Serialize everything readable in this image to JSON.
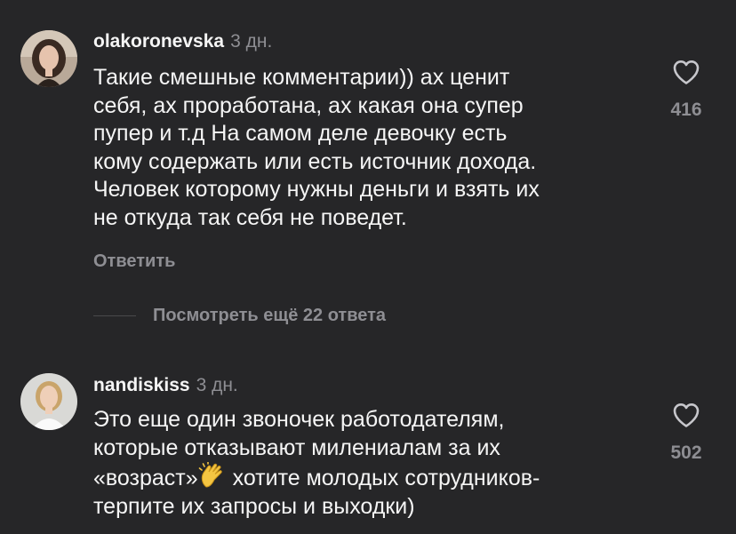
{
  "comments": [
    {
      "username": "olakoronevska",
      "time": "3 дн.",
      "text": "Такие смешные комментарии)) ах ценит\nсебя, ах проработана, ах какая она супер\nпупер  и т.д На самом деле девочку есть\nкому содержать или есть источник дохода.\nЧеловек которому нужны деньги и взять их\nне откуда так себя не поведет.",
      "likes": "416",
      "reply_label": "Ответить",
      "view_replies": "Посмотреть ещё 22 ответа",
      "icons": {
        "like": "heart-icon",
        "avatar": "avatar"
      }
    },
    {
      "username": "nandiskiss",
      "time": "3 дн.",
      "text_before_emoji": "Это еще один звоночек работодателям,\nкоторые отказывают милениалам за их\n«возраст»",
      "text_after_emoji": " хотите молодых сотрудников-\nтерпите их запросы и выходки)",
      "emoji": "clapping-hands-emoji",
      "likes": "502",
      "icons": {
        "like": "heart-icon",
        "avatar": "avatar"
      }
    }
  ],
  "colors": {
    "background": "#262628",
    "text_primary": "#f5f5f5",
    "text_secondary": "#8e8e93",
    "divider": "#4a4a4c"
  }
}
